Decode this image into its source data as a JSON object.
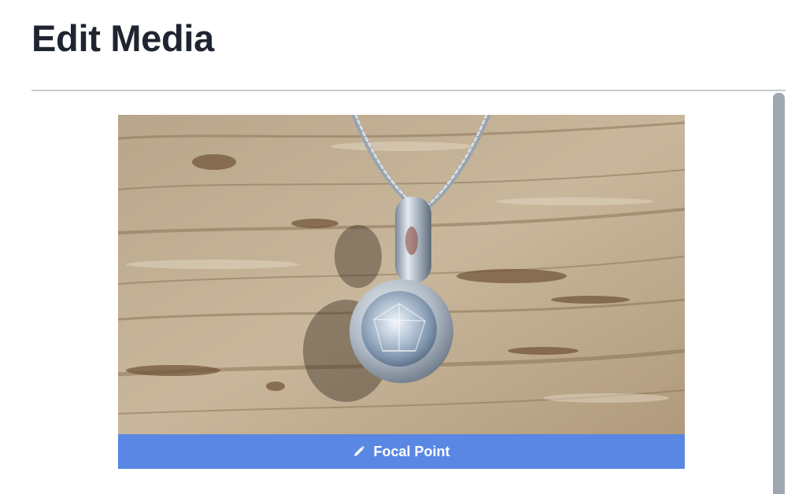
{
  "page": {
    "title": "Edit Media"
  },
  "media": {
    "image_alt": "Diamond pendant on a silver chain resting on weathered wood",
    "focal_point_label": "Focal Point",
    "focal_point_icon": "pencil-icon"
  },
  "colors": {
    "title_text": "#1f2530",
    "accent_button": "#5a87e3",
    "scrollbar": "#9ea6b1",
    "divider": "#c8cbcf"
  }
}
